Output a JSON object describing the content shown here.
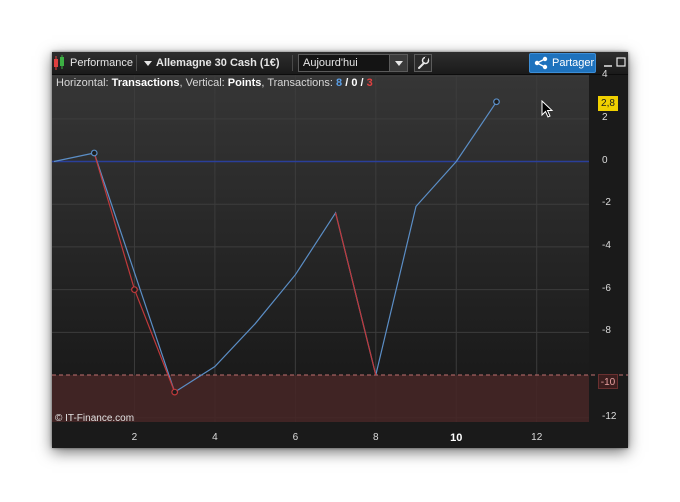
{
  "toolbar": {
    "performance_label": "Performance",
    "instrument_label": "Allemagne 30 Cash (1€)",
    "period_value": "Aujourd'hui",
    "share_label": "Partager"
  },
  "info_bar": {
    "horizontal_prefix": "Horizontal: ",
    "horizontal_value": "Transactions",
    "vertical_prefix": ", Vertical: ",
    "vertical_value": "Points",
    "transactions_prefix": ", Transactions: ",
    "total_count": "8",
    "slash1": " / ",
    "neutral_count": "0",
    "slash2": " / ",
    "losing_count": "3"
  },
  "copyright": "© IT-Finance.com",
  "chart_data": {
    "type": "line",
    "xlabel": "",
    "ylabel": "",
    "xlim": [
      -0.05,
      13.3
    ],
    "ylim": [
      -12.2,
      4.1
    ],
    "x_ticks": [
      {
        "value": 2,
        "label": "2",
        "bold": false
      },
      {
        "value": 4,
        "label": "4",
        "bold": false
      },
      {
        "value": 6,
        "label": "6",
        "bold": false
      },
      {
        "value": 8,
        "label": "8",
        "bold": false
      },
      {
        "value": 10,
        "label": "10",
        "bold": true
      },
      {
        "value": 12,
        "label": "12",
        "bold": false
      }
    ],
    "y_ticks": [
      4,
      2,
      0,
      -2,
      -4,
      -6,
      -8,
      -12
    ],
    "zero_line": 0,
    "loss_threshold": -10,
    "loss_threshold_label": "-10",
    "last_value_label": "2,8",
    "last_value": 2.8,
    "grid": true,
    "series": [
      {
        "color": "#5b8ec6",
        "points": [
          [
            0,
            0
          ],
          [
            1,
            0.4
          ],
          [
            3,
            -10.8
          ],
          [
            4,
            -9.6
          ],
          [
            5,
            -7.6
          ],
          [
            6,
            -5.3
          ],
          [
            7,
            -2.4
          ],
          [
            8,
            -10
          ],
          [
            9,
            -2.1
          ],
          [
            10,
            0
          ],
          [
            11,
            2.8
          ]
        ]
      }
    ],
    "losing_segments": [
      [
        [
          1,
          0.4
        ],
        [
          2,
          -6
        ],
        [
          3,
          -10.8
        ]
      ],
      [
        [
          7,
          -2.4
        ],
        [
          8,
          -10
        ]
      ]
    ],
    "markers": [
      {
        "x": 1,
        "y": 0.4,
        "kind": "blue-hollow"
      },
      {
        "x": 2,
        "y": -6,
        "kind": "red-hollow"
      },
      {
        "x": 3,
        "y": -10.8,
        "kind": "red-hollow"
      },
      {
        "x": 11,
        "y": 2.8,
        "kind": "blue-hollow"
      }
    ]
  },
  "colors": {
    "background": "#1c1c1c",
    "zero_line": "#2a3f9a",
    "losing_line": "#c0393b",
    "winning_line": "#5b8ec6",
    "loss_zone": "#452626",
    "accent": "#1e72bd",
    "last_value_badge": "#f0d000"
  }
}
